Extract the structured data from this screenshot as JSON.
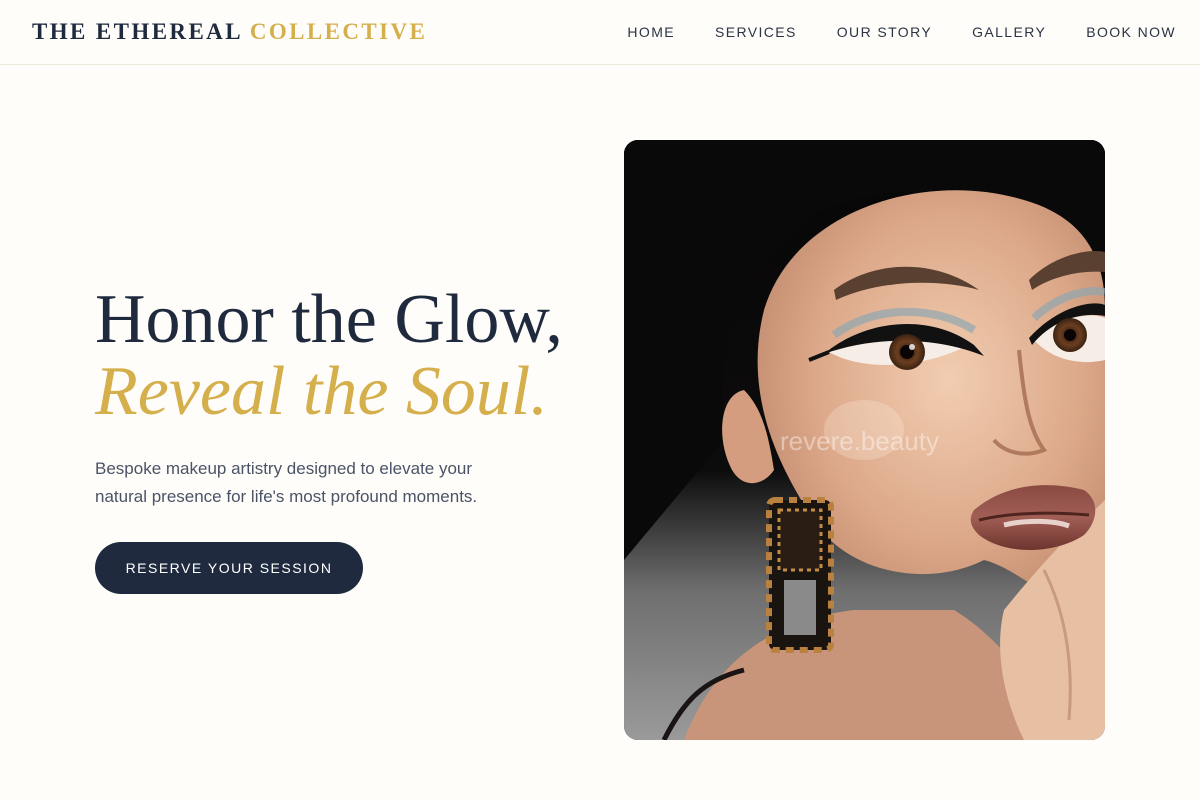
{
  "header": {
    "logo_primary": "THE ETHEREAL",
    "logo_accent": "COLLECTIVE",
    "nav": [
      {
        "label": "HOME"
      },
      {
        "label": "SERVICES"
      },
      {
        "label": "OUR STORY"
      },
      {
        "label": "GALLERY"
      },
      {
        "label": "BOOK NOW"
      }
    ]
  },
  "hero": {
    "title_line_1": "Honor the Glow,",
    "title_line_2": "Reveal the Soul.",
    "subtitle": "Bespoke makeup artistry designed to elevate your natural presence for life's most profound moments.",
    "cta_label": "RESERVE YOUR SESSION",
    "image": {
      "subject": "close-up portrait of a woman with dramatic winged eyeliner, glossy brown lips and jeweled drop earrings",
      "watermark": "revere.beauty"
    }
  },
  "colors": {
    "navy": "#1f2a3e",
    "gold": "#d4af4b",
    "background": "#fefdf9",
    "muted_text": "#4a5366"
  }
}
